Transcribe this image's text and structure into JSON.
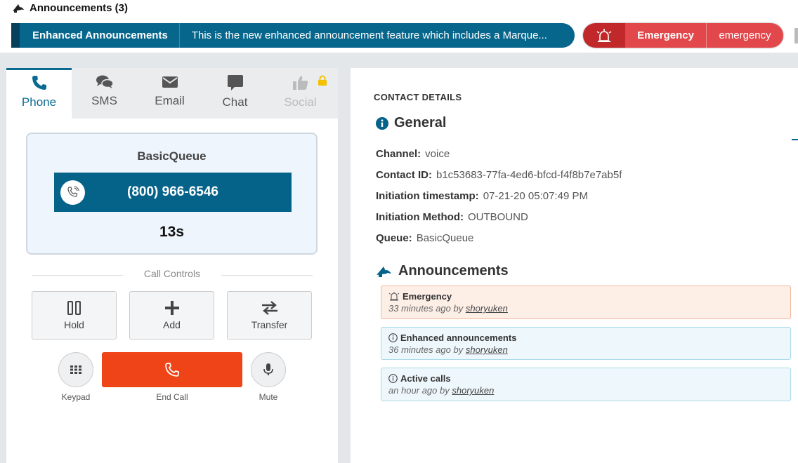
{
  "header": {
    "title": "Announcements (3)"
  },
  "marquee": {
    "name": "Enhanced Announcements",
    "text": "This is the new enhanced announcement feature which includes a Marque..."
  },
  "emergency_pill": {
    "name": "Emergency",
    "text": "emergency"
  },
  "tabs": [
    {
      "label": "Phone",
      "icon": "phone-icon",
      "state": "active"
    },
    {
      "label": "SMS",
      "icon": "chat-bubbles-icon",
      "state": "normal"
    },
    {
      "label": "Email",
      "icon": "envelope-icon",
      "state": "normal"
    },
    {
      "label": "Chat",
      "icon": "chat-icon",
      "state": "normal"
    },
    {
      "label": "Social",
      "icon": "thumbs-up-icon",
      "state": "locked"
    }
  ],
  "call": {
    "queue": "BasicQueue",
    "number": "(800) 966-6546",
    "timer": "13s"
  },
  "call_controls": {
    "label": "Call Controls",
    "hold": "Hold",
    "add": "Add",
    "transfer": "Transfer",
    "keypad": "Keypad",
    "end_call": "End Call",
    "mute": "Mute"
  },
  "contact": {
    "heading": "CONTACT DETAILS",
    "general_title": "General",
    "fields": [
      {
        "label": "Channel:",
        "value": "voice"
      },
      {
        "label": "Contact ID:",
        "value": "b1c53683-77fa-4ed6-bfcd-f4f8b7e7ab5f"
      },
      {
        "label": "Initiation timestamp:",
        "value": "07-21-20 05:07:49 PM"
      },
      {
        "label": "Initiation Method:",
        "value": "OUTBOUND"
      },
      {
        "label": "Queue:",
        "value": "BasicQueue"
      }
    ],
    "announcements_title": "Announcements",
    "announcements": [
      {
        "title": "Emergency",
        "time": "33 minutes ago by",
        "user": "shoryuken",
        "kind": "emergency"
      },
      {
        "title": "Enhanced announcements",
        "time": "36 minutes ago by",
        "user": "shoryuken",
        "kind": "info"
      },
      {
        "title": "Active calls",
        "time": "an hour ago by",
        "user": "shoryuken",
        "kind": "info"
      }
    ]
  },
  "colors": {
    "primary": "#05638a",
    "emergency": "#e2474b",
    "end_call": "#ef4417"
  }
}
